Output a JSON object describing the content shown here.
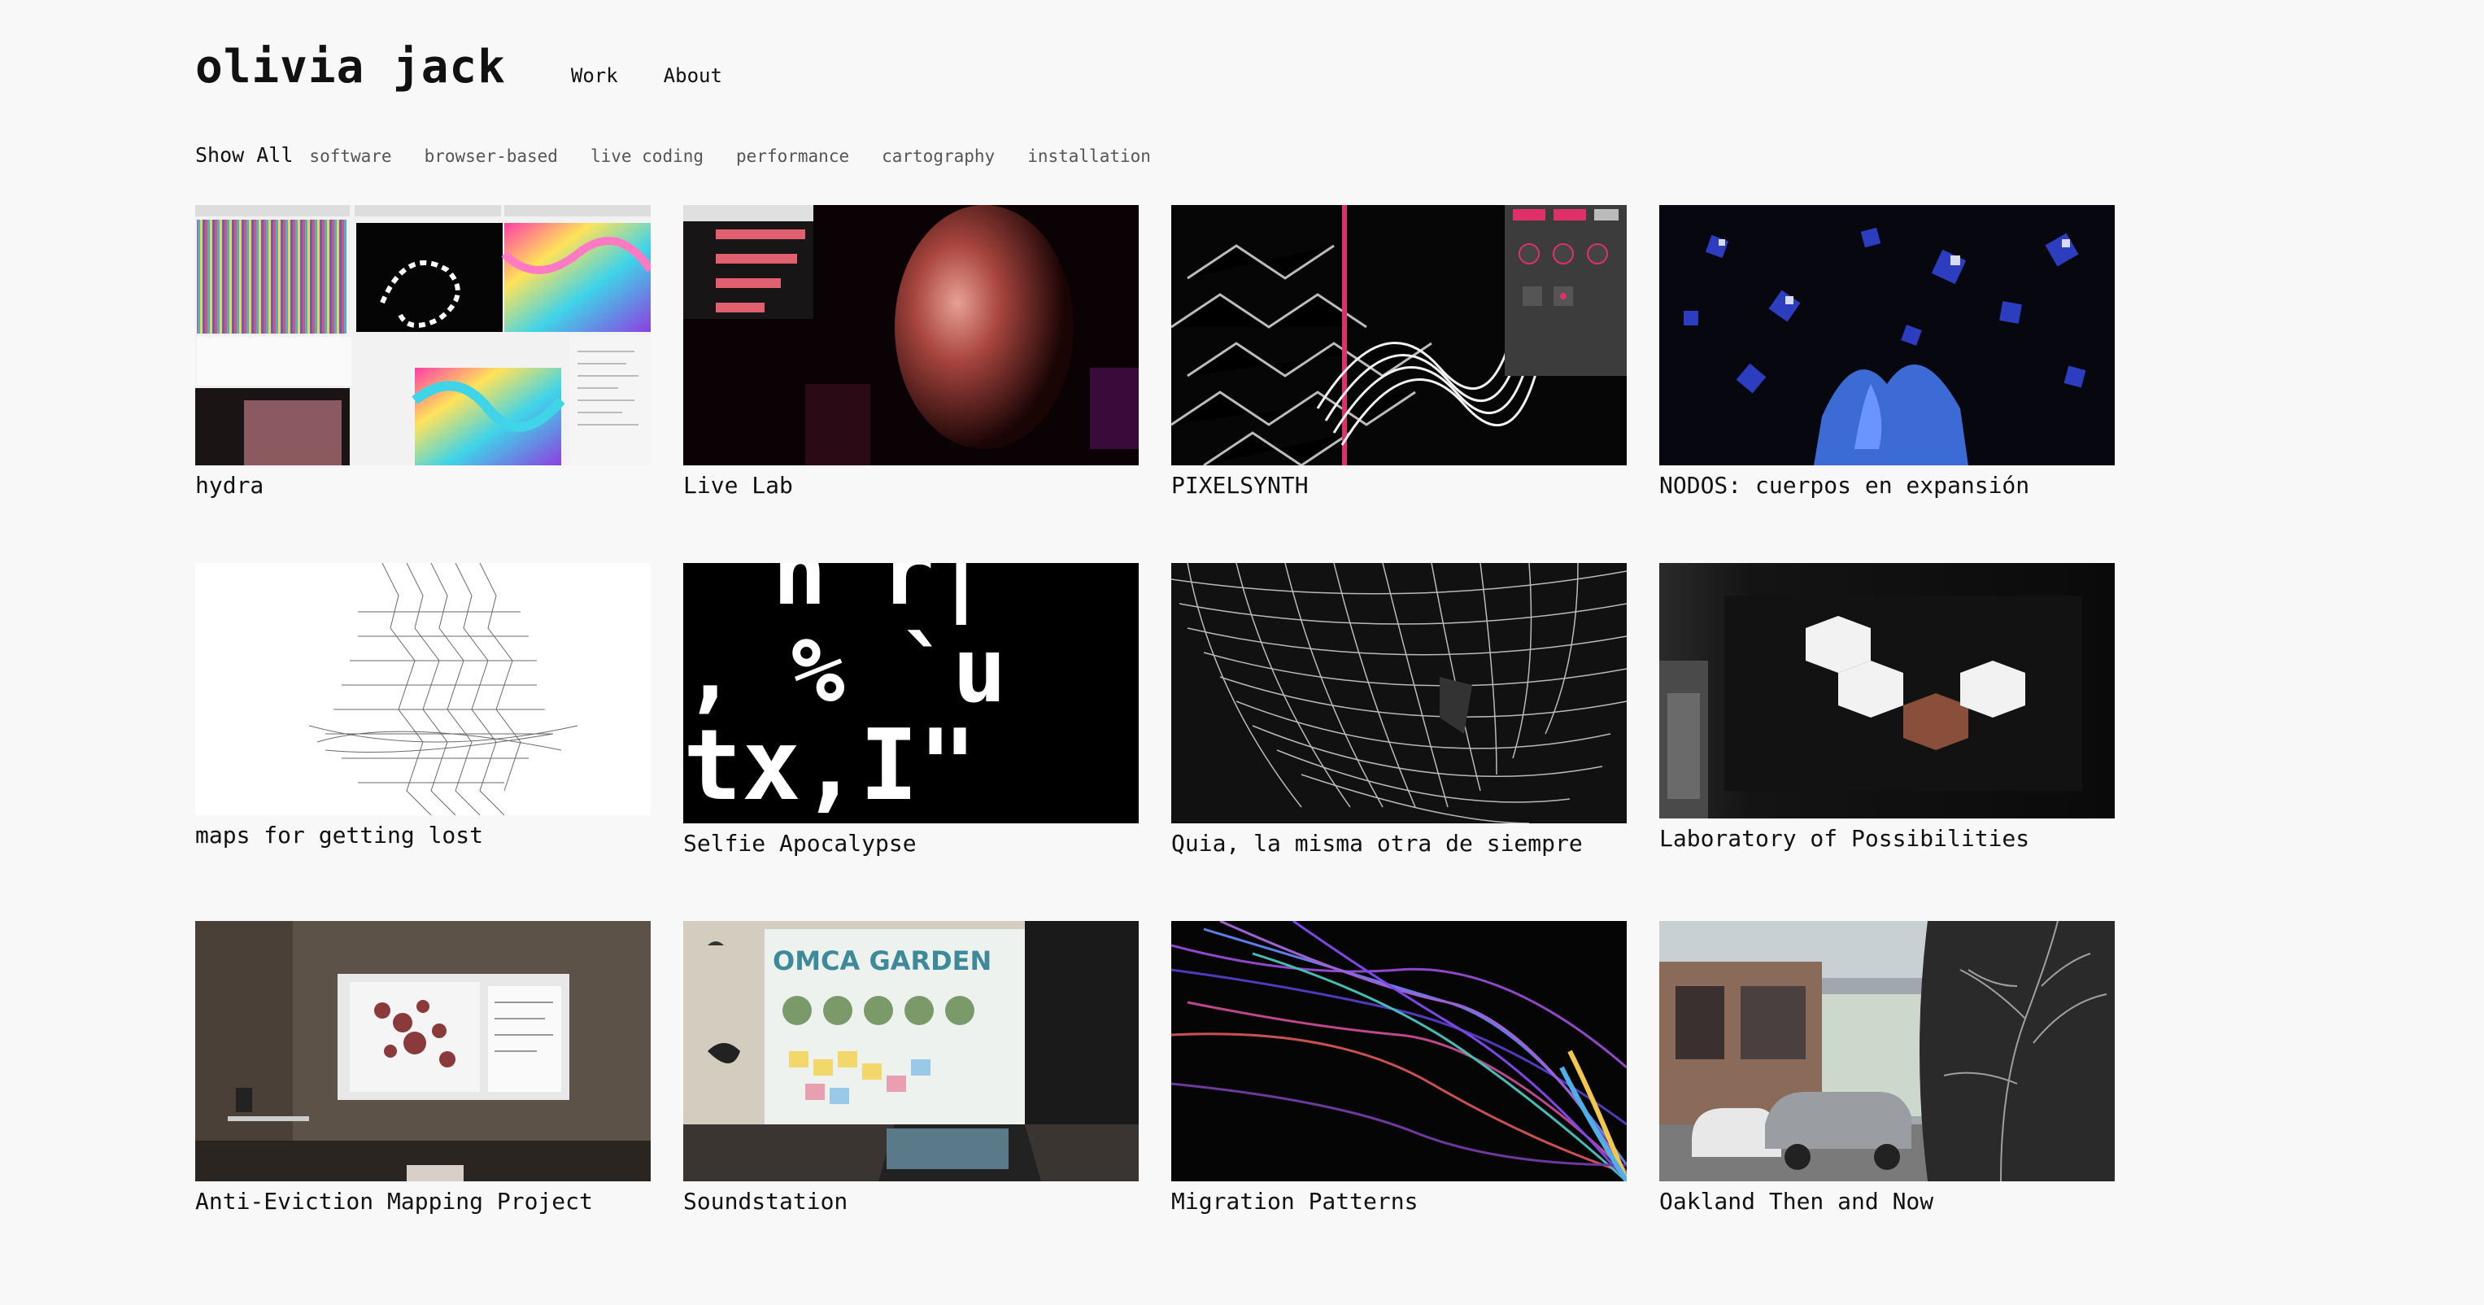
{
  "site": {
    "title": "olivia jack"
  },
  "nav": {
    "work": "Work",
    "about": "About"
  },
  "filters": [
    "Show All",
    "software",
    "browser-based",
    "live coding",
    "performance",
    "cartography",
    "installation"
  ],
  "projects": [
    {
      "title": "hydra"
    },
    {
      "title": "Live Lab"
    },
    {
      "title": "PIXELSYNTH"
    },
    {
      "title": "NODOS: cuerpos en expansión"
    },
    {
      "title": "maps for getting lost"
    },
    {
      "title": "Selfie Apocalypse",
      "thumb_text": [
        "n r|",
        ", % `u",
        "tx,I\""
      ]
    },
    {
      "title": "Quia, la misma otra de siempre"
    },
    {
      "title": "Laboratory of Possibilities"
    },
    {
      "title": "Anti-Eviction Mapping Project"
    },
    {
      "title": "Soundstation",
      "thumb_text": [
        "OMCA GARDEN"
      ]
    },
    {
      "title": "Migration Patterns"
    },
    {
      "title": "Oakland Then and Now"
    }
  ]
}
